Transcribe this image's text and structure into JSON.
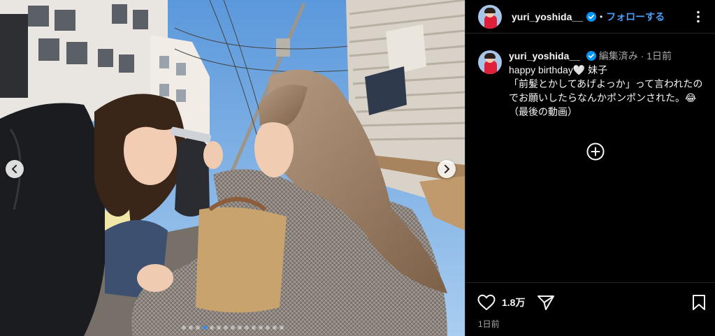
{
  "post": {
    "username": "yuri_yoshida__",
    "follow_label": "フォローする",
    "separator": "•",
    "caption_meta": "編集済み · 1日前",
    "caption_line1": "happy birthday🤍 妹子",
    "caption_line2": "「前髪とかしてあげよっか」って言われたのでお願いしたらなんかポンポンされた。😂（最後の動画）",
    "likes": "1.8万",
    "timestamp": "1日前"
  },
  "carousel": {
    "dot_count": 15,
    "active_index": 3
  },
  "colors": {
    "accent": "#4a9df8",
    "background": "#000000",
    "muted": "#a8a8a8",
    "active_dot": "#3e8ce6"
  },
  "icons": [
    "prev-arrow-icon",
    "next-arrow-icon",
    "more-icon",
    "verified-icon",
    "plus-circle-icon",
    "heart-icon",
    "share-icon",
    "bookmark-icon"
  ]
}
